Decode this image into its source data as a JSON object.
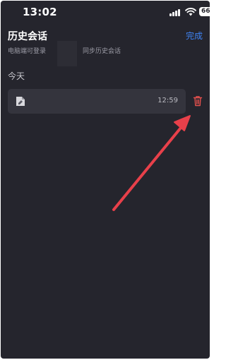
{
  "status_bar": {
    "time": "13:02",
    "battery": "66",
    "icons": [
      "cellular-signal-icon",
      "wifi-icon",
      "battery-icon"
    ]
  },
  "header": {
    "title": "历史会话",
    "done_label": "完成",
    "subtitle_left": "电脑端可登录",
    "subtitle_right": "同步历史会话"
  },
  "section": {
    "label": "今天"
  },
  "conversations": [
    {
      "time": "12:59",
      "icon": "document-icon"
    }
  ],
  "annotation": {
    "color": "#e8404a",
    "points_to": "delete-button"
  },
  "colors": {
    "background": "#25252d",
    "row": "#34343d",
    "accent": "#3f84f5",
    "delete": "#e4504d"
  }
}
